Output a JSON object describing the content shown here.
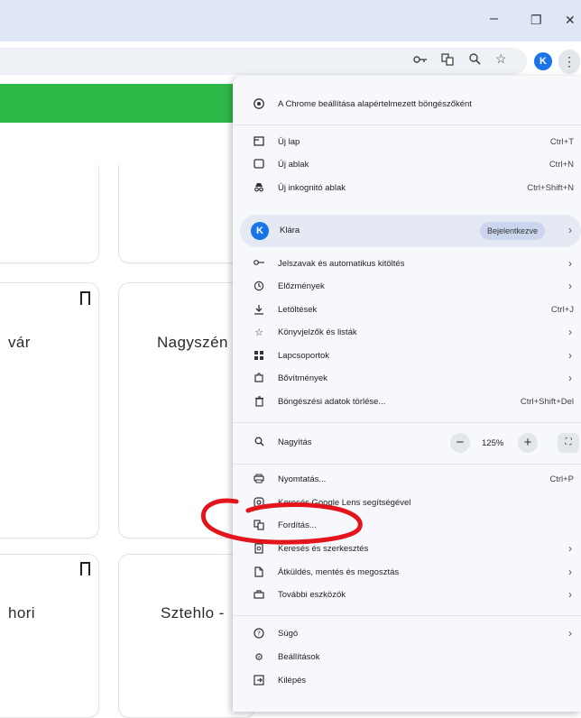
{
  "window": {
    "minimize_icon": "–",
    "restore_icon": "❐",
    "close_icon": "✕"
  },
  "toolbar": {
    "avatar_letter": "K",
    "kebab_glyph": "⋮"
  },
  "cards": [
    {
      "title": "vár"
    },
    {
      "title": "Nagyszén"
    },
    {
      "title": "hori"
    },
    {
      "title": "Sztehlo -"
    }
  ],
  "menu": {
    "default_browser": {
      "label": "A Chrome beállítása alapértelmezett böngészőként"
    },
    "new_tab": {
      "label": "Új lap",
      "shortcut": "Ctrl+T"
    },
    "new_window": {
      "label": "Új ablak",
      "shortcut": "Ctrl+N"
    },
    "incognito": {
      "label": "Új inkognitó ablak",
      "shortcut": "Ctrl+Shift+N"
    },
    "profile": {
      "avatar_letter": "K",
      "name": "Klára",
      "status": "Bejelentkezve"
    },
    "passwords": {
      "label": "Jelszavak és automatikus kitöltés"
    },
    "history": {
      "label": "Előzmények"
    },
    "downloads": {
      "label": "Letöltések",
      "shortcut": "Ctrl+J"
    },
    "bookmarks": {
      "label": "Könyvjelzők és listák"
    },
    "tab_groups": {
      "label": "Lapcsoportok"
    },
    "extensions": {
      "label": "Bővítmények"
    },
    "clear_data": {
      "label": "Böngészési adatok törlése...",
      "shortcut": "Ctrl+Shift+Del"
    },
    "zoom": {
      "label": "Nagyítás",
      "minus": "−",
      "value": "125%",
      "plus": "+",
      "fullscreen_glyph": "⛶"
    },
    "print": {
      "label": "Nyomtatás...",
      "shortcut": "Ctrl+P"
    },
    "lens": {
      "label": "Keresés Google Lens segítségével"
    },
    "translate": {
      "label": "Fordítás..."
    },
    "find_edit": {
      "label": "Keresés és szerkesztés"
    },
    "cast_save_share": {
      "label": "Átküldés, mentés és megosztás"
    },
    "more_tools": {
      "label": "További eszközök"
    },
    "help": {
      "label": "Súgó"
    },
    "settings": {
      "label": "Beállítások"
    },
    "exit": {
      "label": "Kilépés"
    }
  },
  "annotation": {
    "color": "#e3141b"
  }
}
